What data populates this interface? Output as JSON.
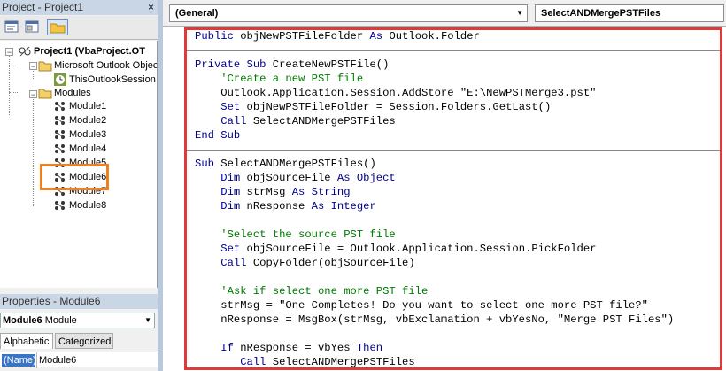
{
  "project_panel": {
    "title": "Project - Project1",
    "close_glyph": "×",
    "toolbar": [
      "view-code",
      "view-object",
      "toggle-folders"
    ],
    "tree": {
      "root": "Project1 (VbaProject.OT",
      "folder1": "Microsoft Outlook Objec",
      "folder1_item": "ThisOutlookSession",
      "folder2": "Modules",
      "modules": [
        "Module1",
        "Module2",
        "Module3",
        "Module4",
        "Module5",
        "Module6",
        "Module7",
        "Module8"
      ],
      "highlighted": "Module6"
    }
  },
  "properties_panel": {
    "title": "Properties - Module6",
    "object_bold": "Module6",
    "object_type": "Module",
    "tabs": [
      "Alphabetic",
      "Categorized"
    ],
    "row": {
      "name": "(Name)",
      "value": "Module6"
    }
  },
  "code_window": {
    "object_combo": "(General)",
    "procedure_combo": "SelectANDMergePSTFiles",
    "lines": [
      [
        [
          "kw",
          "Public "
        ],
        [
          "",
          "objNewPSTFileFolder "
        ],
        [
          "kw",
          "As "
        ],
        [
          "",
          "Outlook.Folder"
        ]
      ],
      [],
      [
        [
          "kw",
          "Private Sub "
        ],
        [
          "",
          "CreateNewPSTFile()"
        ]
      ],
      [
        [
          "cm",
          "    'Create a new PST file"
        ]
      ],
      [
        [
          "",
          "    Outlook.Application.Session.AddStore \"E:\\NewPSTMerge3.pst\""
        ]
      ],
      [
        [
          "kw",
          "    Set "
        ],
        [
          "",
          "objNewPSTFileFolder = Session.Folders.GetLast()"
        ]
      ],
      [
        [
          "kw",
          "    Call "
        ],
        [
          "",
          "SelectANDMergePSTFiles"
        ]
      ],
      [
        [
          "kw",
          "End Sub"
        ]
      ],
      [],
      [
        [
          "kw",
          "Sub "
        ],
        [
          "",
          "SelectANDMergePSTFiles()"
        ]
      ],
      [
        [
          "kw",
          "    Dim "
        ],
        [
          "",
          "objSourceFile "
        ],
        [
          "kw",
          "As Object"
        ]
      ],
      [
        [
          "kw",
          "    Dim "
        ],
        [
          "",
          "strMsg "
        ],
        [
          "kw",
          "As String"
        ]
      ],
      [
        [
          "kw",
          "    Dim "
        ],
        [
          "",
          "nResponse "
        ],
        [
          "kw",
          "As Integer"
        ]
      ],
      [],
      [
        [
          "cm",
          "    'Select the source PST file"
        ]
      ],
      [
        [
          "kw",
          "    Set "
        ],
        [
          "",
          "objSourceFile = Outlook.Application.Session.PickFolder"
        ]
      ],
      [
        [
          "kw",
          "    Call "
        ],
        [
          "",
          "CopyFolder(objSourceFile)"
        ]
      ],
      [],
      [
        [
          "cm",
          "    'Ask if select one more PST file"
        ]
      ],
      [
        [
          "",
          "    strMsg = \"One Completes! Do you want to select one more PST file?\""
        ]
      ],
      [
        [
          "",
          "    nResponse = MsgBox(strMsg, vbExclamation + vbYesNo, \"Merge PST Files\")"
        ]
      ],
      [],
      [
        [
          "kw",
          "    If "
        ],
        [
          "",
          "nResponse = vbYes "
        ],
        [
          "kw",
          "Then"
        ]
      ],
      [
        [
          "kw",
          "       Call "
        ],
        [
          "",
          "SelectANDMergePSTFiles"
        ]
      ]
    ]
  },
  "colors": {
    "keyword": "#00008b",
    "comment": "#007a00",
    "highlight_orange": "#f07f1e",
    "highlight_red": "#e0393a"
  }
}
